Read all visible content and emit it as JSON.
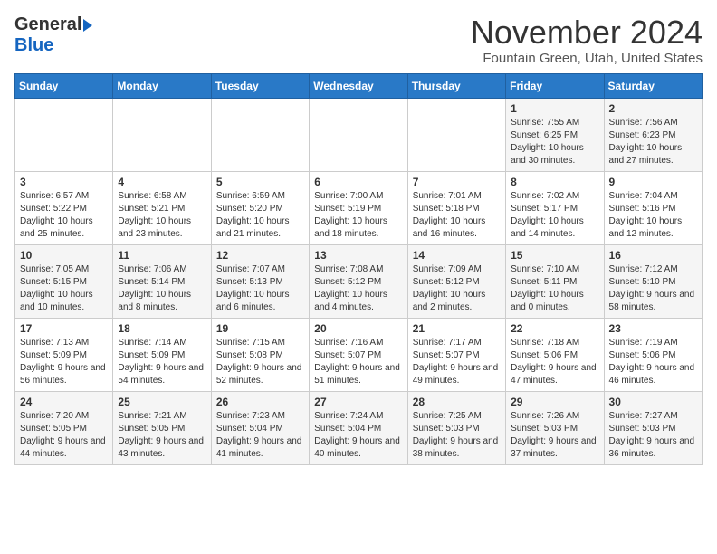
{
  "header": {
    "logo_general": "General",
    "logo_blue": "Blue",
    "month": "November 2024",
    "location": "Fountain Green, Utah, United States"
  },
  "days_of_week": [
    "Sunday",
    "Monday",
    "Tuesday",
    "Wednesday",
    "Thursday",
    "Friday",
    "Saturday"
  ],
  "weeks": [
    [
      {
        "day": "",
        "info": ""
      },
      {
        "day": "",
        "info": ""
      },
      {
        "day": "",
        "info": ""
      },
      {
        "day": "",
        "info": ""
      },
      {
        "day": "",
        "info": ""
      },
      {
        "day": "1",
        "info": "Sunrise: 7:55 AM\nSunset: 6:25 PM\nDaylight: 10 hours and 30 minutes."
      },
      {
        "day": "2",
        "info": "Sunrise: 7:56 AM\nSunset: 6:23 PM\nDaylight: 10 hours and 27 minutes."
      }
    ],
    [
      {
        "day": "3",
        "info": "Sunrise: 6:57 AM\nSunset: 5:22 PM\nDaylight: 10 hours and 25 minutes."
      },
      {
        "day": "4",
        "info": "Sunrise: 6:58 AM\nSunset: 5:21 PM\nDaylight: 10 hours and 23 minutes."
      },
      {
        "day": "5",
        "info": "Sunrise: 6:59 AM\nSunset: 5:20 PM\nDaylight: 10 hours and 21 minutes."
      },
      {
        "day": "6",
        "info": "Sunrise: 7:00 AM\nSunset: 5:19 PM\nDaylight: 10 hours and 18 minutes."
      },
      {
        "day": "7",
        "info": "Sunrise: 7:01 AM\nSunset: 5:18 PM\nDaylight: 10 hours and 16 minutes."
      },
      {
        "day": "8",
        "info": "Sunrise: 7:02 AM\nSunset: 5:17 PM\nDaylight: 10 hours and 14 minutes."
      },
      {
        "day": "9",
        "info": "Sunrise: 7:04 AM\nSunset: 5:16 PM\nDaylight: 10 hours and 12 minutes."
      }
    ],
    [
      {
        "day": "10",
        "info": "Sunrise: 7:05 AM\nSunset: 5:15 PM\nDaylight: 10 hours and 10 minutes."
      },
      {
        "day": "11",
        "info": "Sunrise: 7:06 AM\nSunset: 5:14 PM\nDaylight: 10 hours and 8 minutes."
      },
      {
        "day": "12",
        "info": "Sunrise: 7:07 AM\nSunset: 5:13 PM\nDaylight: 10 hours and 6 minutes."
      },
      {
        "day": "13",
        "info": "Sunrise: 7:08 AM\nSunset: 5:12 PM\nDaylight: 10 hours and 4 minutes."
      },
      {
        "day": "14",
        "info": "Sunrise: 7:09 AM\nSunset: 5:12 PM\nDaylight: 10 hours and 2 minutes."
      },
      {
        "day": "15",
        "info": "Sunrise: 7:10 AM\nSunset: 5:11 PM\nDaylight: 10 hours and 0 minutes."
      },
      {
        "day": "16",
        "info": "Sunrise: 7:12 AM\nSunset: 5:10 PM\nDaylight: 9 hours and 58 minutes."
      }
    ],
    [
      {
        "day": "17",
        "info": "Sunrise: 7:13 AM\nSunset: 5:09 PM\nDaylight: 9 hours and 56 minutes."
      },
      {
        "day": "18",
        "info": "Sunrise: 7:14 AM\nSunset: 5:09 PM\nDaylight: 9 hours and 54 minutes."
      },
      {
        "day": "19",
        "info": "Sunrise: 7:15 AM\nSunset: 5:08 PM\nDaylight: 9 hours and 52 minutes."
      },
      {
        "day": "20",
        "info": "Sunrise: 7:16 AM\nSunset: 5:07 PM\nDaylight: 9 hours and 51 minutes."
      },
      {
        "day": "21",
        "info": "Sunrise: 7:17 AM\nSunset: 5:07 PM\nDaylight: 9 hours and 49 minutes."
      },
      {
        "day": "22",
        "info": "Sunrise: 7:18 AM\nSunset: 5:06 PM\nDaylight: 9 hours and 47 minutes."
      },
      {
        "day": "23",
        "info": "Sunrise: 7:19 AM\nSunset: 5:06 PM\nDaylight: 9 hours and 46 minutes."
      }
    ],
    [
      {
        "day": "24",
        "info": "Sunrise: 7:20 AM\nSunset: 5:05 PM\nDaylight: 9 hours and 44 minutes."
      },
      {
        "day": "25",
        "info": "Sunrise: 7:21 AM\nSunset: 5:05 PM\nDaylight: 9 hours and 43 minutes."
      },
      {
        "day": "26",
        "info": "Sunrise: 7:23 AM\nSunset: 5:04 PM\nDaylight: 9 hours and 41 minutes."
      },
      {
        "day": "27",
        "info": "Sunrise: 7:24 AM\nSunset: 5:04 PM\nDaylight: 9 hours and 40 minutes."
      },
      {
        "day": "28",
        "info": "Sunrise: 7:25 AM\nSunset: 5:03 PM\nDaylight: 9 hours and 38 minutes."
      },
      {
        "day": "29",
        "info": "Sunrise: 7:26 AM\nSunset: 5:03 PM\nDaylight: 9 hours and 37 minutes."
      },
      {
        "day": "30",
        "info": "Sunrise: 7:27 AM\nSunset: 5:03 PM\nDaylight: 9 hours and 36 minutes."
      }
    ]
  ]
}
